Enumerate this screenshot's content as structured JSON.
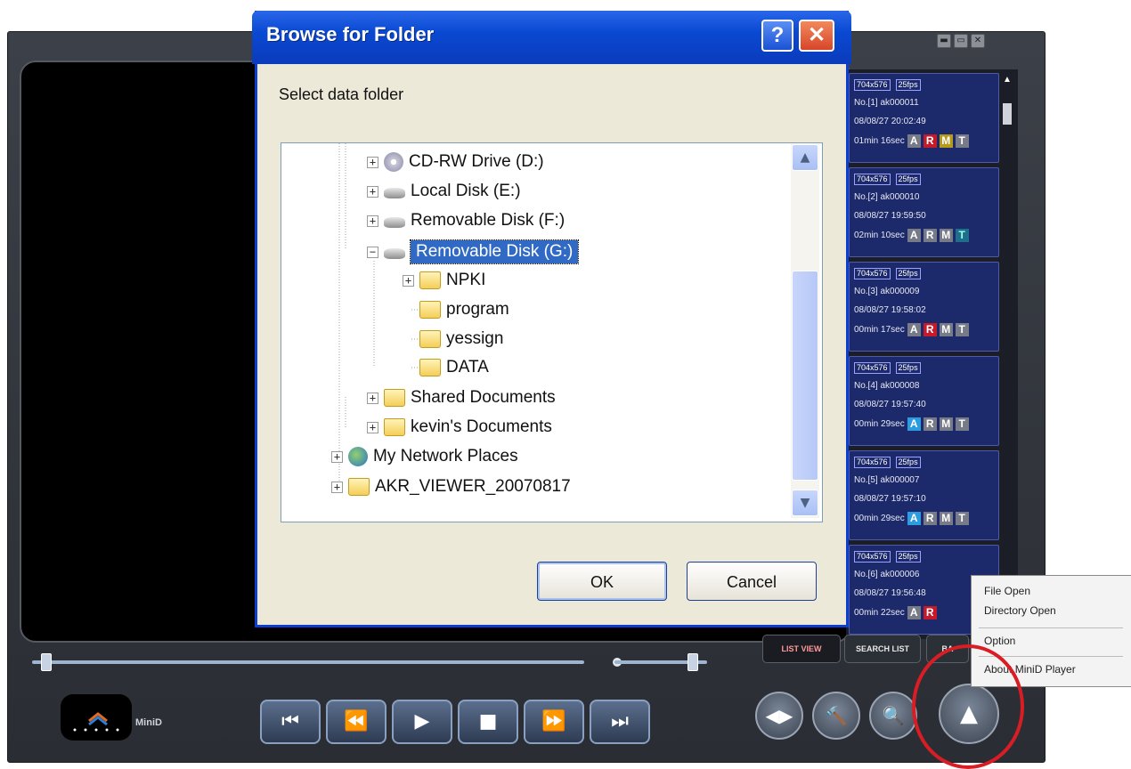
{
  "player": {
    "window_buttons": [
      "▬",
      "▭",
      "✕"
    ],
    "list_items": [
      {
        "res": "704x576",
        "fps": "25fps",
        "no": "No.[1] ak000011",
        "dt": "08/08/27 20:02:49",
        "dur": "01min 16sec",
        "flags": [
          "A",
          "R",
          "M",
          "T"
        ],
        "flag_colors": [
          "gray",
          "red",
          "gold",
          "gray"
        ]
      },
      {
        "res": "704x576",
        "fps": "25fps",
        "no": "No.[2] ak000010",
        "dt": "08/08/27 19:59:50",
        "dur": "02min 10sec",
        "flags": [
          "A",
          "R",
          "M",
          "T"
        ],
        "flag_colors": [
          "gray",
          "gray",
          "gray",
          "teal"
        ]
      },
      {
        "res": "704x576",
        "fps": "25fps",
        "no": "No.[3] ak000009",
        "dt": "08/08/27 19:58:02",
        "dur": "00min 17sec",
        "flags": [
          "A",
          "R",
          "M",
          "T"
        ],
        "flag_colors": [
          "gray",
          "red",
          "gray",
          "gray"
        ]
      },
      {
        "res": "704x576",
        "fps": "25fps",
        "no": "No.[4] ak000008",
        "dt": "08/08/27 19:57:40",
        "dur": "00min 29sec",
        "flags": [
          "A",
          "R",
          "M",
          "T"
        ],
        "flag_colors": [
          "blue",
          "gray",
          "gray",
          "gray"
        ]
      },
      {
        "res": "704x576",
        "fps": "25fps",
        "no": "No.[5] ak000007",
        "dt": "08/08/27 19:57:10",
        "dur": "00min 29sec",
        "flags": [
          "A",
          "R",
          "M",
          "T"
        ],
        "flag_colors": [
          "blue",
          "gray",
          "gray",
          "gray"
        ]
      },
      {
        "res": "704x576",
        "fps": "25fps",
        "no": "No.[6] ak000006",
        "dt": "08/08/27 19:56:48",
        "dur": "00min 22sec",
        "flags": [
          "A",
          "R"
        ],
        "flag_colors": [
          "gray",
          "red"
        ]
      }
    ],
    "tabs": {
      "list_view": "LIST VIEW",
      "search_list": "SEARCH LIST",
      "third": "BA"
    },
    "logo_label": "MiniD",
    "transport": {
      "prev": "⏮",
      "rewind": "⏪",
      "play": "▶",
      "stop": "■",
      "forward": "⏩",
      "next": "⏭"
    },
    "circle_buttons": {
      "ab": "◀▶",
      "tools": "🔨",
      "search": "🔍",
      "up": "▲"
    }
  },
  "context_menu": {
    "file_open": "File Open",
    "directory_open": "Directory Open",
    "option": "Option",
    "about": "About MiniD Player"
  },
  "dialog": {
    "title": "Browse for Folder",
    "help": "?",
    "close": "✕",
    "prompt": "Select data folder",
    "tree": [
      {
        "label": "CD-RW Drive (D:)",
        "icon": "cd-drive-icon",
        "expander": "+"
      },
      {
        "label": "Local Disk (E:)",
        "icon": "hard-drive-icon",
        "expander": "+"
      },
      {
        "label": "Removable Disk (F:)",
        "icon": "removable-drive-icon",
        "expander": "+"
      },
      {
        "label": "Removable Disk (G:)",
        "icon": "removable-drive-icon",
        "expander": "−",
        "selected": true
      },
      {
        "label": "NPKI",
        "icon": "folder-icon",
        "expander": "+"
      },
      {
        "label": "program",
        "icon": "folder-icon",
        "expander": ""
      },
      {
        "label": "yessign",
        "icon": "folder-icon",
        "expander": ""
      },
      {
        "label": "DATA",
        "icon": "folder-icon",
        "expander": ""
      },
      {
        "label": "Shared Documents",
        "icon": "folder-icon",
        "expander": "+"
      },
      {
        "label": "kevin's Documents",
        "icon": "folder-icon",
        "expander": "+"
      },
      {
        "label": "My Network Places",
        "icon": "network-icon",
        "expander": "+"
      },
      {
        "label": "AKR_VIEWER_20070817",
        "icon": "folder-icon",
        "expander": "+"
      }
    ],
    "ok": "OK",
    "cancel": "Cancel"
  }
}
